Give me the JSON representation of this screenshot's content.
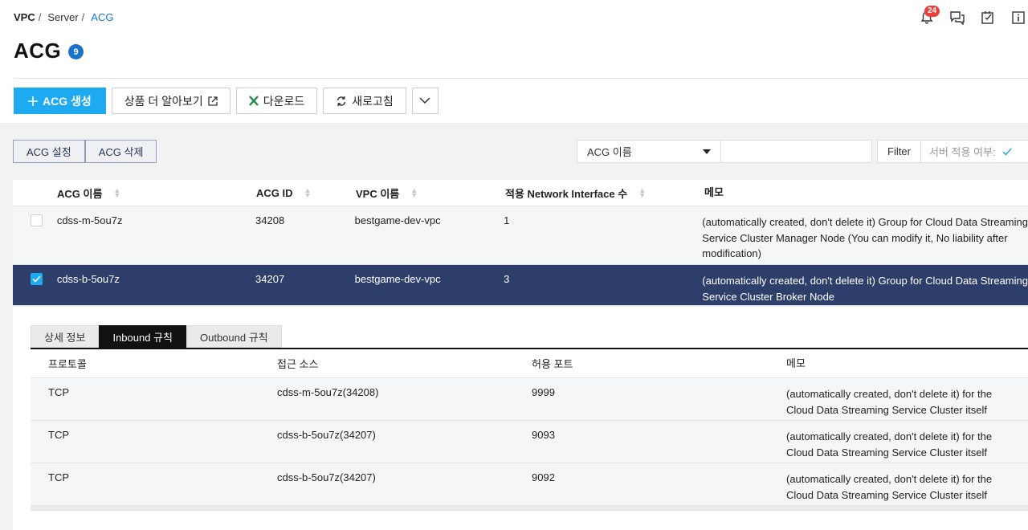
{
  "breadcrumb": {
    "root": "VPC",
    "mid": "Server",
    "current": "ACG",
    "sep": "/"
  },
  "notifications": {
    "count": "24"
  },
  "page": {
    "title": "ACG",
    "count": "9"
  },
  "toolbar": {
    "create": "ACG 생성",
    "learn_more": "상품 더 알아보기",
    "download": "다운로드",
    "refresh": "새로고침"
  },
  "actions": {
    "settings": "ACG 설정",
    "delete": "ACG 삭제"
  },
  "search": {
    "field_selected": "ACG 이름",
    "query": "",
    "filter_label": "Filter",
    "filter_state": "서버 적용 여부:"
  },
  "table": {
    "columns": [
      "ACG 이름",
      "ACG ID",
      "VPC 이름",
      "적용 Network Interface 수",
      "메모"
    ],
    "rows": [
      {
        "checked": false,
        "name": "cdss-m-5ou7z",
        "id": "34208",
        "vpc": "bestgame-dev-vpc",
        "ni": "1",
        "memo": [
          "(automatically created, don't delete it) Group for Cloud Data Streaming",
          "Service Cluster Manager Node (You can modify it, No liability after",
          "modification)"
        ]
      },
      {
        "checked": true,
        "name": "cdss-b-5ou7z",
        "id": "34207",
        "vpc": "bestgame-dev-vpc",
        "ni": "3",
        "memo": [
          "(automatically created, don't delete it) Group for Cloud Data Streaming",
          "Service Cluster Broker Node"
        ]
      }
    ]
  },
  "detail_tabs": [
    "상세 정보",
    "Inbound 규칙",
    "Outbound 규칙"
  ],
  "active_tab": "Inbound 규칙",
  "rules": {
    "columns": [
      "프로토콜",
      "접근 소스",
      "허용 포트",
      "메모"
    ],
    "rows": [
      {
        "protocol": "TCP",
        "source": "cdss-m-5ou7z(34208)",
        "port": "9999",
        "memo": [
          "(automatically created, don't delete it) for the",
          "Cloud Data Streaming Service Cluster itself"
        ]
      },
      {
        "protocol": "TCP",
        "source": "cdss-b-5ou7z(34207)",
        "port": "9093",
        "memo": [
          "(automatically created, don't delete it) for the",
          "Cloud Data Streaming Service Cluster itself"
        ]
      },
      {
        "protocol": "TCP",
        "source": "cdss-b-5ou7z(34207)",
        "port": "9092",
        "memo": [
          "(automatically created, don't delete it) for the",
          "Cloud Data Streaming Service Cluster itself"
        ]
      }
    ]
  },
  "colors": {
    "primary": "#1eaaf1",
    "selected_row": "#2e3e6b",
    "link": "#1a73c8",
    "badge": "#e8413b"
  },
  "icons": [
    "bell-icon",
    "chat-icon",
    "memo-icon",
    "info-icon",
    "plus-icon",
    "external-link-icon",
    "excel-icon",
    "refresh-icon",
    "chevron-down-icon",
    "search-icon",
    "check-icon"
  ]
}
